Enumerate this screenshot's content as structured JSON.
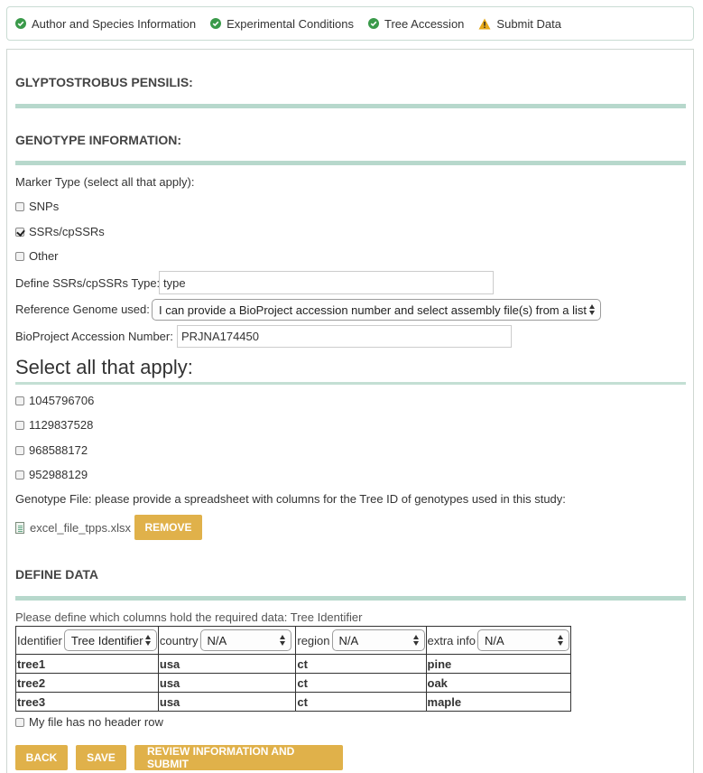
{
  "steps": [
    {
      "label": "Author and Species Information",
      "status": "done"
    },
    {
      "label": "Experimental Conditions",
      "status": "done"
    },
    {
      "label": "Tree Accession",
      "status": "done"
    },
    {
      "label": "Submit Data",
      "status": "warning"
    }
  ],
  "colors": {
    "done": "#3a9a4a",
    "warning": "#e6a817",
    "accent": "#e0b14a",
    "rule": "#b7d8cc"
  },
  "species": {
    "title": "GLYPTOSTROBUS PENSILIS:"
  },
  "genotype": {
    "title": "GENOTYPE INFORMATION:",
    "marker_label": "Marker Type (select all that apply):",
    "markers": [
      {
        "label": "SNPs",
        "checked": false
      },
      {
        "label": "SSRs/cpSSRs",
        "checked": true
      },
      {
        "label": "Other",
        "checked": false
      }
    ],
    "ssr_type_label": "Define SSRs/cpSSRs Type:",
    "ssr_type_value": "type",
    "ref_genome_label": "Reference Genome used:",
    "ref_genome_value": "I can provide a BioProject accession number and select assembly file(s) from a list",
    "bioproject_label": "BioProject Accession Number:",
    "bioproject_value": "PRJNA174450",
    "select_all_title": "Select all that apply:",
    "assemblies": [
      {
        "label": "1045796706",
        "checked": false
      },
      {
        "label": "1129837528",
        "checked": false
      },
      {
        "label": "968588172",
        "checked": false
      },
      {
        "label": "952988129",
        "checked": false
      }
    ],
    "file_label": "Genotype File: please provide a spreadsheet with columns for the Tree ID of genotypes used in this study:",
    "file_name": "excel_file_tpps.xlsx",
    "remove_label": "REMOVE"
  },
  "define_data": {
    "title": "DEFINE DATA",
    "instructions": "Please define which columns hold the required data: Tree Identifier",
    "headers": [
      {
        "name": "Identifier",
        "select": "Tree Identifier"
      },
      {
        "name": "country",
        "select": "N/A"
      },
      {
        "name": "region",
        "select": "N/A"
      },
      {
        "name": "extra info",
        "select": "N/A"
      }
    ],
    "rows": [
      [
        "tree1",
        "usa",
        "ct",
        "pine"
      ],
      [
        "tree2",
        "usa",
        "ct",
        "oak"
      ],
      [
        "tree3",
        "usa",
        "ct",
        "maple"
      ]
    ],
    "no_header_label": "My file has no header row"
  },
  "buttons": {
    "back": "BACK",
    "save": "SAVE",
    "review": "REVIEW INFORMATION AND SUBMIT"
  }
}
